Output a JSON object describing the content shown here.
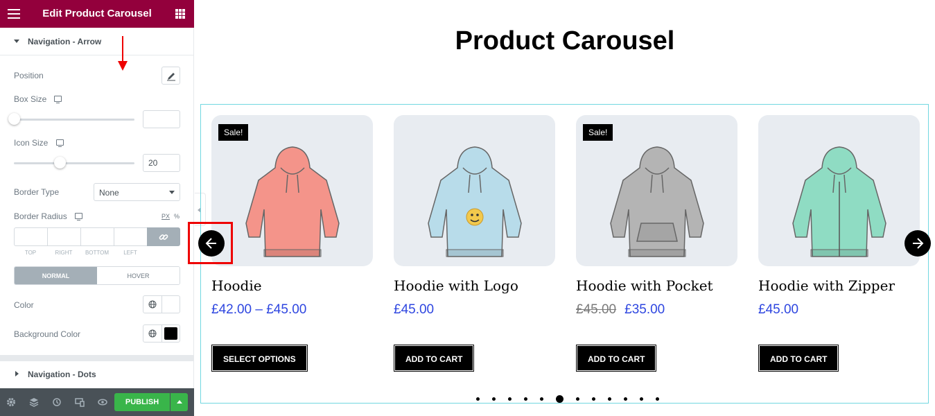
{
  "sidebar": {
    "title": "Edit Product Carousel",
    "section_arrow": "Navigation - Arrow",
    "section_dots": "Navigation - Dots",
    "position_label": "Position",
    "box_size_label": "Box Size",
    "box_size_value": "",
    "icon_size_label": "Icon Size",
    "icon_size_value": "20",
    "border_type_label": "Border Type",
    "border_type_value": "None",
    "border_radius_label": "Border Radius",
    "unit_px": "PX",
    "unit_pct": "%",
    "dims": [
      "TOP",
      "RIGHT",
      "BOTTOM",
      "LEFT"
    ],
    "tab_normal": "NORMAL",
    "tab_hover": "HOVER",
    "color_label": "Color",
    "bg_color_label": "Background Color",
    "bg_color_value": "#000000",
    "publish_label": "PUBLISH",
    "header_color": "#93003c",
    "publish_color": "#39b54a"
  },
  "preview": {
    "title": "Product Carousel",
    "products": [
      {
        "name": "Hoodie",
        "price": "£42.00 – £45.00",
        "old_price": "",
        "sale": "Sale!",
        "button": "SELECT OPTIONS",
        "color": "#f4948a",
        "icon": "hoodie-icon"
      },
      {
        "name": "Hoodie with Logo",
        "price": "£45.00",
        "old_price": "",
        "sale": "",
        "button": "ADD TO CART",
        "color": "#b8dcea",
        "icon": "hoodie-logo-icon"
      },
      {
        "name": "Hoodie with Pocket",
        "price": "£35.00",
        "old_price": "£45.00",
        "sale": "Sale!",
        "button": "ADD TO CART",
        "color": "#b4b4b4",
        "icon": "hoodie-pocket-icon"
      },
      {
        "name": "Hoodie with Zipper",
        "price": "£45.00",
        "old_price": "",
        "sale": "",
        "button": "ADD TO CART",
        "color": "#8fdcc3",
        "icon": "hoodie-zipper-icon"
      }
    ],
    "dots_count": 12,
    "active_dot": 5,
    "price_color": "#2e46e0"
  }
}
